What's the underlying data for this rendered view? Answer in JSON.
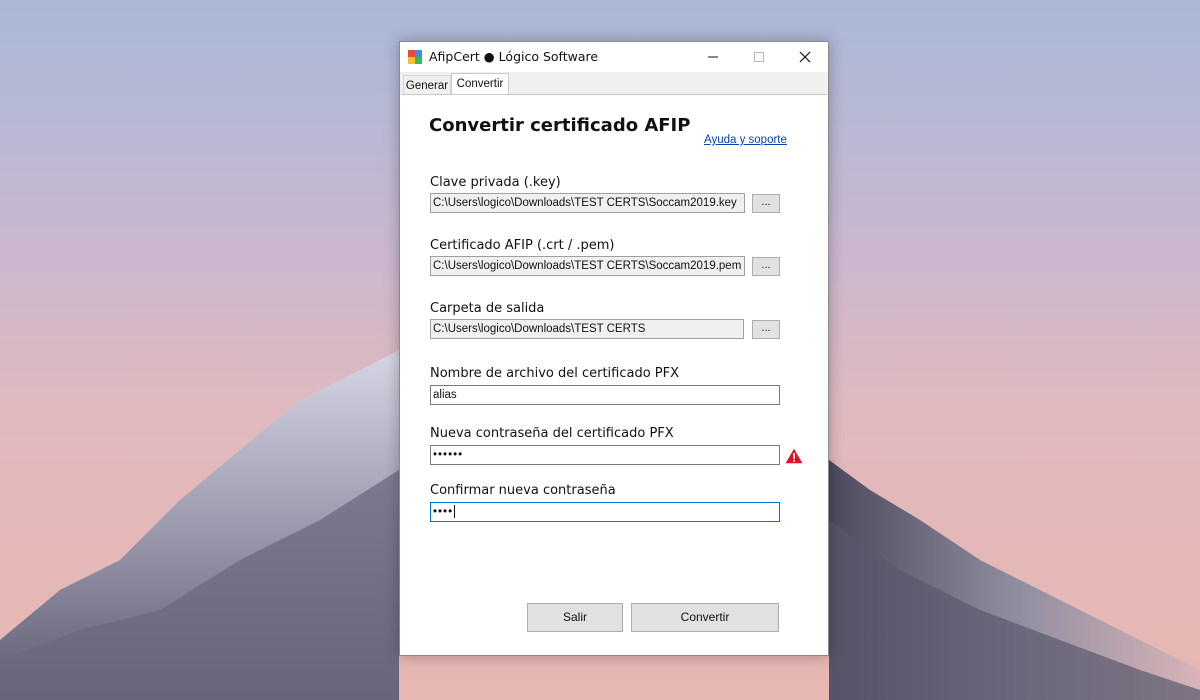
{
  "window": {
    "title": "AfipCert ● Lógico Software"
  },
  "tabs": [
    {
      "label": "Generar"
    },
    {
      "label": "Convertir",
      "active": true
    }
  ],
  "form": {
    "heading": "Convertir certificado AFIP",
    "help_link": "Ayuda y soporte",
    "private_key": {
      "label": "Clave privada (.key)",
      "value": "C:\\Users\\logico\\Downloads\\TEST CERTS\\Soccam2019.key",
      "browse_label": "..."
    },
    "certificate": {
      "label": "Certificado AFIP (.crt / .pem)",
      "value": "C:\\Users\\logico\\Downloads\\TEST CERTS\\Soccam2019.pem",
      "browse_label": "..."
    },
    "output_folder": {
      "label": "Carpeta de salida",
      "value": "C:\\Users\\logico\\Downloads\\TEST CERTS",
      "browse_label": "..."
    },
    "pfx_name": {
      "label": "Nombre de archivo del certificado PFX",
      "value": "alias"
    },
    "new_password": {
      "label": "Nueva contraseña del certificado PFX",
      "value": "••••••"
    },
    "confirm_password": {
      "label": "Confirmar nueva contraseña",
      "value": "••••"
    }
  },
  "buttons": {
    "exit": "Salir",
    "convert": "Convertir"
  },
  "colors": {
    "link": "#0645ad",
    "warning": "#e81123",
    "focus": "#0078d7"
  },
  "icons": {
    "warning": "warning-triangle-icon",
    "app": "app-icon"
  }
}
